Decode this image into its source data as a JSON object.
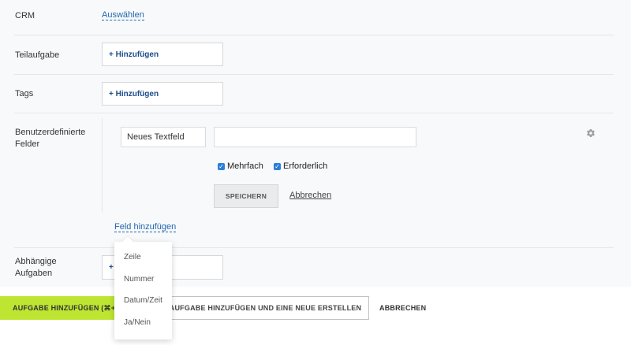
{
  "crm": {
    "label": "CRM",
    "link": "Auswählen"
  },
  "subtask": {
    "label": "Teilaufgabe",
    "add": "+ Hinzufügen"
  },
  "tags": {
    "label": "Tags",
    "add": "+ Hinzufügen"
  },
  "custom_fields": {
    "label_line1": "Benutzerdefinierte",
    "label_line2": "Felder",
    "field_name": "Neues Textfeld",
    "field_value": "",
    "checkbox_multiple": "Mehrfach",
    "checkbox_required": "Erforderlich",
    "save": "SPEICHERN",
    "cancel": "Abbrechen",
    "add_field": "Feld hinzufügen",
    "settings_icon": "gear-icon"
  },
  "dependent": {
    "label_line1": "Abhängige",
    "label_line2": "Aufgaben",
    "add": "+"
  },
  "field_type_menu": [
    "Zeile",
    "Nummer",
    "Datum/Zeit",
    "Ja/Nein"
  ],
  "footer": {
    "primary": "AUFGABE HINZUFÜGEN (⌘+E",
    "secondary": "AUFGABE HINZUFÜGEN UND EINE NEUE ERSTELLEN",
    "cancel": "ABBRECHEN"
  },
  "colors": {
    "accent": "#bde532",
    "link": "#2067b0",
    "checkbox": "#2a7ed8"
  }
}
